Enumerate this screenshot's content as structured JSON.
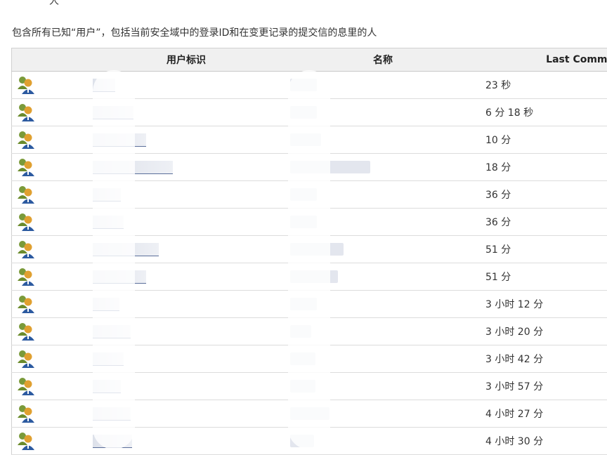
{
  "header_fragment": "人",
  "intro_text": "包含所有已知“用户”，包括当前安全域中的登录ID和在变更记录的提交信的息里的人",
  "table": {
    "columns": {
      "user_id": "用户标识",
      "name": "名称",
      "last_commit": "Last Commit"
    },
    "rows": [
      {
        "last_commit": "23 秒"
      },
      {
        "last_commit": "6 分 18 秒"
      },
      {
        "last_commit": "10 分"
      },
      {
        "last_commit": "18 分"
      },
      {
        "last_commit": "36 分"
      },
      {
        "last_commit": "36 分"
      },
      {
        "last_commit": "51 分"
      },
      {
        "last_commit": "51 分"
      },
      {
        "last_commit": "3 小时 12 分"
      },
      {
        "last_commit": "3 小时 20 分"
      },
      {
        "last_commit": "3 小时 42 分"
      },
      {
        "last_commit": "3 小时 57 分"
      },
      {
        "last_commit": "4 小时 27 分"
      },
      {
        "last_commit": "4 小时 30 分"
      }
    ]
  },
  "icons": {
    "user": "user-icon",
    "header_logo": "header-logo-icon"
  }
}
